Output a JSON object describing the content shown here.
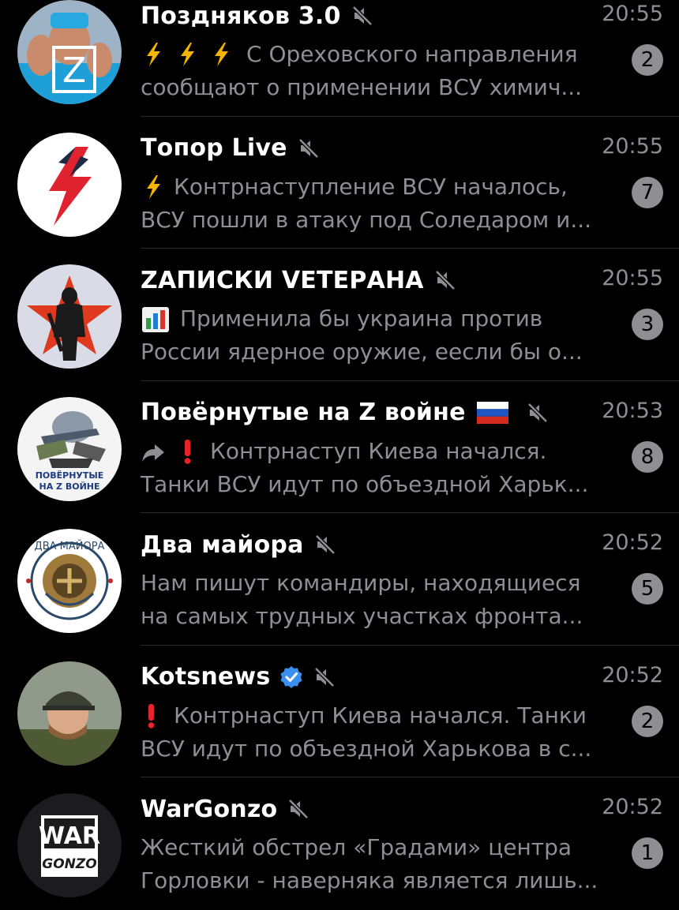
{
  "chats": [
    {
      "name": "Поздняков 3.0",
      "time": "20:55",
      "line1": "С Ореховского направления",
      "line2": "сообщают о применении ВСУ химич...",
      "unread": "2",
      "prefix_icon": "lightning-triple-icon",
      "muted": true
    },
    {
      "name": "Топор Live",
      "time": "20:55",
      "line1": "Контрнаступление ВСУ началось,",
      "line2": "ВСУ пошли в атаку под Соледаром и...",
      "unread": "7",
      "prefix_icon": "lightning-icon",
      "muted": true
    },
    {
      "name": "ZАПИСКИ VЕТЕРАНА",
      "time": "20:55",
      "line1": "Применила бы украина против",
      "line2": "России ядерное оружие, еесли бы о...",
      "unread": "3",
      "prefix_icon": "bar-chart-icon",
      "muted": true
    },
    {
      "name": "Повёрнутые на Z войне",
      "time": "20:53",
      "line1": "Контрнаступ Киева начался.",
      "line2": "Танки ВСУ идут по объездной Харьк...",
      "unread": "8",
      "prefix_icon": "forward-exclamation-icon",
      "muted": true,
      "avatar_text": [
        "ПОВЁРНУТЫЕ",
        "НА Z ВОЙНЕ"
      ]
    },
    {
      "name": "Два майора",
      "time": "20:52",
      "line1": "Нам пишут командиры, находящиеся",
      "line2": "на самых трудных участках фронта...",
      "unread": "5",
      "prefix_icon": "",
      "muted": true,
      "avatar_text": [
        "ДВА МАЙОРА"
      ]
    },
    {
      "name": "Kotsnews",
      "time": "20:52",
      "line1": "Контрнаступ Киева начался. Танки",
      "line2": "ВСУ идут по объездной Харькова в с...",
      "unread": "2",
      "prefix_icon": "exclamation-icon",
      "muted": true,
      "verified": true
    },
    {
      "name": "WarGonzo",
      "time": "20:52",
      "line1": "Жесткий обстрел «Градами» центра",
      "line2": "Горловки - наверняка является лишь...",
      "unread": "1",
      "prefix_icon": "",
      "muted": true,
      "avatar_text": [
        "WAR",
        "GONZO"
      ]
    }
  ],
  "colors": {
    "background": "#000000",
    "secondary_text": "#8e8e93",
    "badge": "#8e8e93",
    "verified": "#3b8ff0"
  }
}
